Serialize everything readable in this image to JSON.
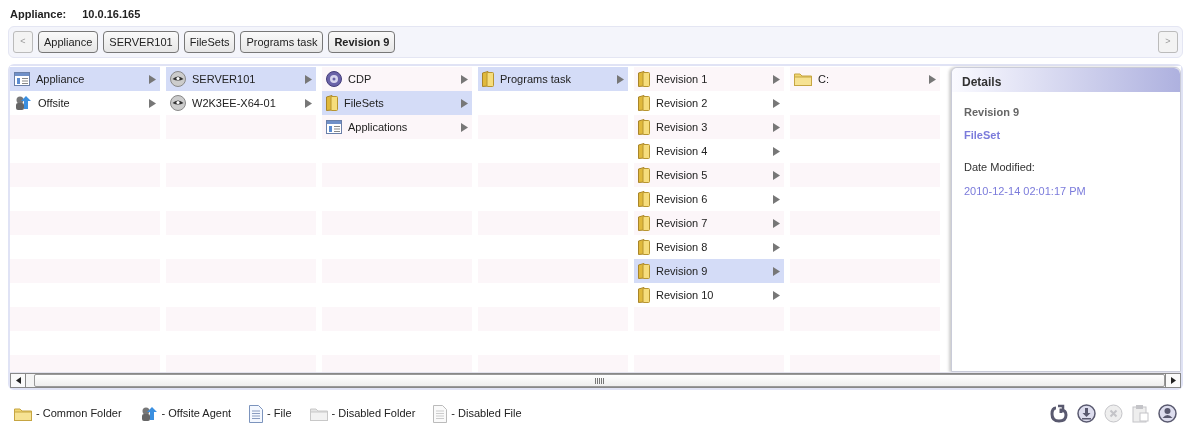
{
  "header": {
    "label": "Appliance:",
    "value": "10.0.16.165"
  },
  "breadcrumb": {
    "back": {
      "text": "<",
      "disabled": true
    },
    "crumbs": [
      {
        "label": "Appliance",
        "selected": false
      },
      {
        "label": "SERVER101",
        "selected": false
      },
      {
        "label": "FileSets",
        "selected": false
      },
      {
        "label": "Programs task",
        "selected": false
      },
      {
        "label": "Revision 9",
        "selected": true
      }
    ],
    "forward": {
      "text": ">",
      "disabled": true
    }
  },
  "columns": [
    {
      "items": [
        {
          "kind": "appliance",
          "label": "Appliance",
          "selected": true
        },
        {
          "kind": "offsite",
          "label": "Offsite",
          "selected": false
        }
      ]
    },
    {
      "items": [
        {
          "kind": "server",
          "label": "SERVER101",
          "selected": true
        },
        {
          "kind": "server",
          "label": "W2K3EE-X64-01",
          "selected": false
        }
      ]
    },
    {
      "items": [
        {
          "kind": "cdp",
          "label": "CDP",
          "selected": false
        },
        {
          "kind": "fileset",
          "label": "FileSets",
          "selected": true
        },
        {
          "kind": "applications",
          "label": "Applications",
          "selected": false
        }
      ]
    },
    {
      "items": [
        {
          "kind": "fileset",
          "label": "Programs task",
          "selected": true
        }
      ]
    },
    {
      "items": [
        {
          "kind": "fileset",
          "label": "Revision 1",
          "selected": false
        },
        {
          "kind": "fileset",
          "label": "Revision 2",
          "selected": false
        },
        {
          "kind": "fileset",
          "label": "Revision 3",
          "selected": false
        },
        {
          "kind": "fileset",
          "label": "Revision 4",
          "selected": false
        },
        {
          "kind": "fileset",
          "label": "Revision 5",
          "selected": false
        },
        {
          "kind": "fileset",
          "label": "Revision 6",
          "selected": false
        },
        {
          "kind": "fileset",
          "label": "Revision 7",
          "selected": false
        },
        {
          "kind": "fileset",
          "label": "Revision 8",
          "selected": false
        },
        {
          "kind": "fileset",
          "label": "Revision 9",
          "selected": true
        },
        {
          "kind": "fileset",
          "label": "Revision 10",
          "selected": false
        }
      ]
    },
    {
      "items": [
        {
          "kind": "folder",
          "label": "C:",
          "selected": false
        }
      ]
    }
  ],
  "details": {
    "title": "Details",
    "name": "Revision 9",
    "type": "FileSet",
    "date_label": "Date Modified:",
    "date": "2010-12-14 02:01:17 PM"
  },
  "legend": [
    {
      "kind": "folder",
      "label": "- Common Folder"
    },
    {
      "kind": "offsite",
      "label": "- Offsite Agent"
    },
    {
      "kind": "file",
      "label": "- File"
    },
    {
      "kind": "disabled-folder",
      "label": "- Disabled Folder"
    },
    {
      "kind": "disabled-file",
      "label": "- Disabled File"
    }
  ],
  "tools": [
    {
      "kind": "restore",
      "disabled": false
    },
    {
      "kind": "download",
      "disabled": false
    },
    {
      "kind": "close",
      "disabled": true
    },
    {
      "kind": "clipboard",
      "disabled": true
    },
    {
      "kind": "user",
      "disabled": false
    }
  ]
}
